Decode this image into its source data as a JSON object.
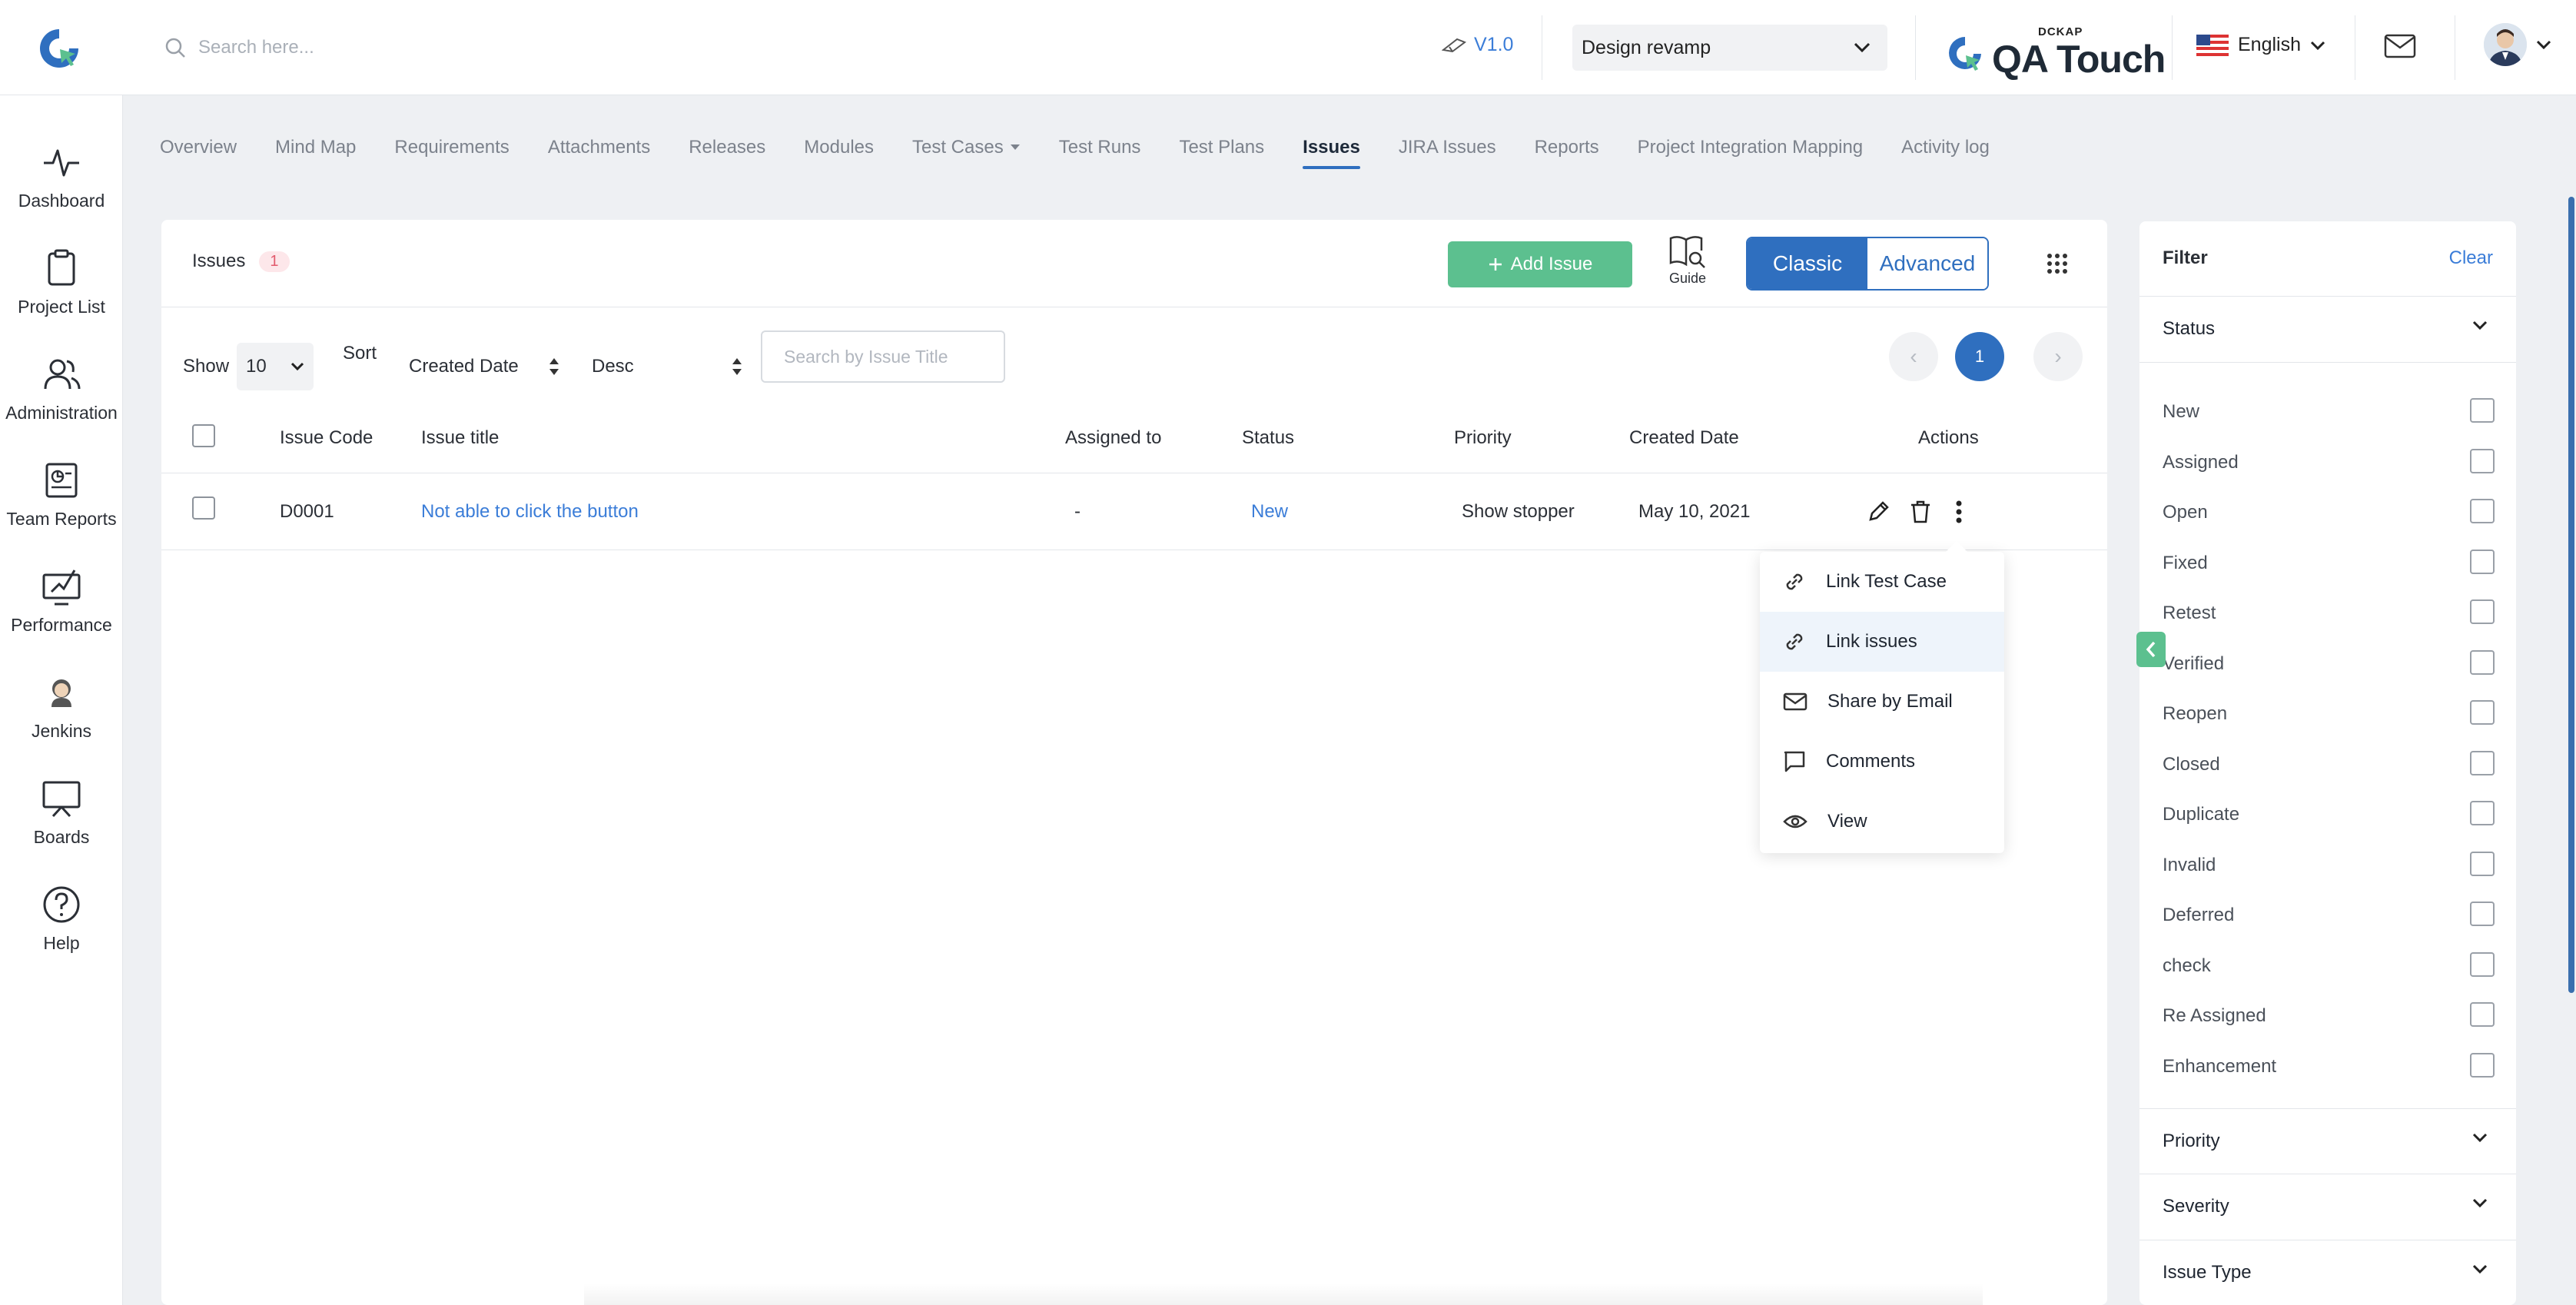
{
  "header": {
    "search_placeholder": "Search here...",
    "version": "V1.0",
    "project": "Design revamp",
    "brand_small": "DCKAP",
    "brand_large": "QA Touch",
    "language": "English"
  },
  "nav": [
    {
      "label": "Dashboard",
      "icon": "pulse-icon"
    },
    {
      "label": "Project List",
      "icon": "clipboard-icon"
    },
    {
      "label": "Administration",
      "icon": "users-icon"
    },
    {
      "label": "Team Reports",
      "icon": "report-icon"
    },
    {
      "label": "Performance",
      "icon": "performance-icon"
    },
    {
      "label": "Jenkins",
      "icon": "jenkins-icon"
    },
    {
      "label": "Boards",
      "icon": "board-icon"
    },
    {
      "label": "Help",
      "icon": "help-icon"
    }
  ],
  "tabs": [
    {
      "label": "Overview"
    },
    {
      "label": "Mind Map"
    },
    {
      "label": "Requirements"
    },
    {
      "label": "Attachments"
    },
    {
      "label": "Releases"
    },
    {
      "label": "Modules"
    },
    {
      "label": "Test Cases"
    },
    {
      "label": "Test Runs"
    },
    {
      "label": "Test Plans"
    },
    {
      "label": "Issues"
    },
    {
      "label": "JIRA Issues"
    },
    {
      "label": "Reports"
    },
    {
      "label": "Project Integration Mapping"
    },
    {
      "label": "Activity log"
    }
  ],
  "issues": {
    "title": "Issues",
    "count": "1",
    "add_label": "Add Issue",
    "guide_label": "Guide",
    "view_classic": "Classic",
    "view_advanced": "Advanced",
    "show_label": "Show",
    "show_value": "10",
    "sort_label": "Sort",
    "sort_field": "Created Date",
    "sort_order": "Desc",
    "search_placeholder": "Search by Issue Title",
    "page_prev": "‹",
    "page_current": "1",
    "page_next": "›",
    "columns": {
      "code": "Issue Code",
      "title": "Issue title",
      "assigned": "Assigned to",
      "status": "Status",
      "priority": "Priority",
      "created": "Created Date",
      "actions": "Actions"
    },
    "rows": [
      {
        "code": "D0001",
        "title": "Not able to click the button",
        "assigned": "-",
        "status": "New",
        "priority": "Show stopper",
        "created": "May 10, 2021"
      }
    ],
    "menu": [
      {
        "label": "Link Test Case",
        "icon": "link-icon"
      },
      {
        "label": "Link issues",
        "icon": "link-icon"
      },
      {
        "label": "Share by Email",
        "icon": "mail-icon"
      },
      {
        "label": "Comments",
        "icon": "comment-icon"
      },
      {
        "label": "View",
        "icon": "eye-icon"
      }
    ]
  },
  "filter": {
    "title": "Filter",
    "clear": "Clear",
    "status_label": "Status",
    "status_options": [
      "New",
      "Assigned",
      "Open",
      "Fixed",
      "Retest",
      "Verified",
      "Reopen",
      "Closed",
      "Duplicate",
      "Invalid",
      "Deferred",
      "check",
      "Re Assigned",
      "Enhancement"
    ],
    "priority_label": "Priority",
    "severity_label": "Severity",
    "issue_type_label": "Issue Type"
  },
  "colors": {
    "accent": "#2f6fbf",
    "green": "#5cc08f",
    "badge_bg": "#fde7ea"
  }
}
